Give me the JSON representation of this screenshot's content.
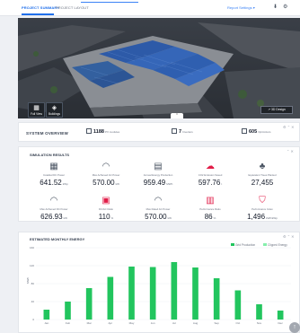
{
  "topbar": {
    "tab_summary": "PROJECT SUMMARY",
    "tab_layout": "PROJECT LAYOUT",
    "report_settings": "Report Settings",
    "report_chevron": "▾",
    "accent": "#1f6feb"
  },
  "viewport": {
    "btn_full_view": "Full View",
    "btn_buildings": "Buildings",
    "btn_3d_design": "3D Design",
    "pad_chevron": "⌃"
  },
  "overview": {
    "title": "SYSTEM OVERVIEW",
    "modules_value": "1188",
    "modules_unit": "PV modules",
    "inverters_value": "7",
    "inverters_unit": "Inverters",
    "optimizers_value": "605",
    "optimizers_unit": "Optimizers",
    "dots": "⚙ ⌃ ✕"
  },
  "simulation": {
    "title": "SIMULATION RESULTS",
    "dots": "⌃ ✕",
    "tiles": [
      {
        "label": "Installed DC Power",
        "value": "641.52",
        "unit": "kWp",
        "icon": "solar-panel-icon"
      },
      {
        "label": "Max Achieved AC Power",
        "value": "570.00",
        "unit": "kW",
        "icon": "gauge-icon"
      },
      {
        "label": "Annual Energy Production",
        "value": "959.49",
        "unit": "MWh",
        "icon": "calendar-icon"
      },
      {
        "label": "CO2 Emission Saved",
        "value": "597.76",
        "unit": "t",
        "icon": "cloud-icon"
      },
      {
        "label": "Equivalent Trees Planted",
        "value": "27,455",
        "unit": "",
        "icon": "tree-icon"
      },
      {
        "label": "Max Achieved DC Power",
        "value": "626.93",
        "unit": "kW",
        "icon": "gauge-icon"
      },
      {
        "label": "DC/AC Ratio",
        "value": "110",
        "unit": "%",
        "icon": "ratio-icon"
      },
      {
        "label": "Max Rated AC Power",
        "value": "570.00",
        "unit": "kW",
        "icon": "gauge-icon"
      },
      {
        "label": "Performance Ratio",
        "value": "86",
        "unit": "%",
        "icon": "bar-chart-icon"
      },
      {
        "label": "Performance Index",
        "value": "1,496",
        "unit": "kWh/kWp",
        "icon": "shield-icon"
      }
    ]
  },
  "energy": {
    "title": "ESTIMATED MONTHLY ENERGY",
    "dots": "⚙ ⌃ ✕",
    "legend_gen": "Grid Production",
    "legend_loss": "Clipped Energy",
    "color_gen": "#22c55e",
    "color_loss": "#86efac"
  },
  "chart_data": {
    "type": "bar",
    "title": "ESTIMATED MONTHLY ENERGY",
    "xlabel": "",
    "ylabel": "MWh",
    "categories": [
      "Jan",
      "Feb",
      "Mar",
      "Apr",
      "May",
      "Jun",
      "Jul",
      "Aug",
      "Sep",
      "Oct",
      "Nov",
      "Dec"
    ],
    "series": [
      {
        "name": "Grid Production",
        "values": [
          22,
          40,
          70,
          95,
          118,
          117,
          128,
          116,
          92,
          65,
          34,
          20
        ]
      }
    ],
    "yticks": [
      0,
      40,
      80,
      120,
      160
    ],
    "ylim": [
      0,
      160
    ]
  }
}
